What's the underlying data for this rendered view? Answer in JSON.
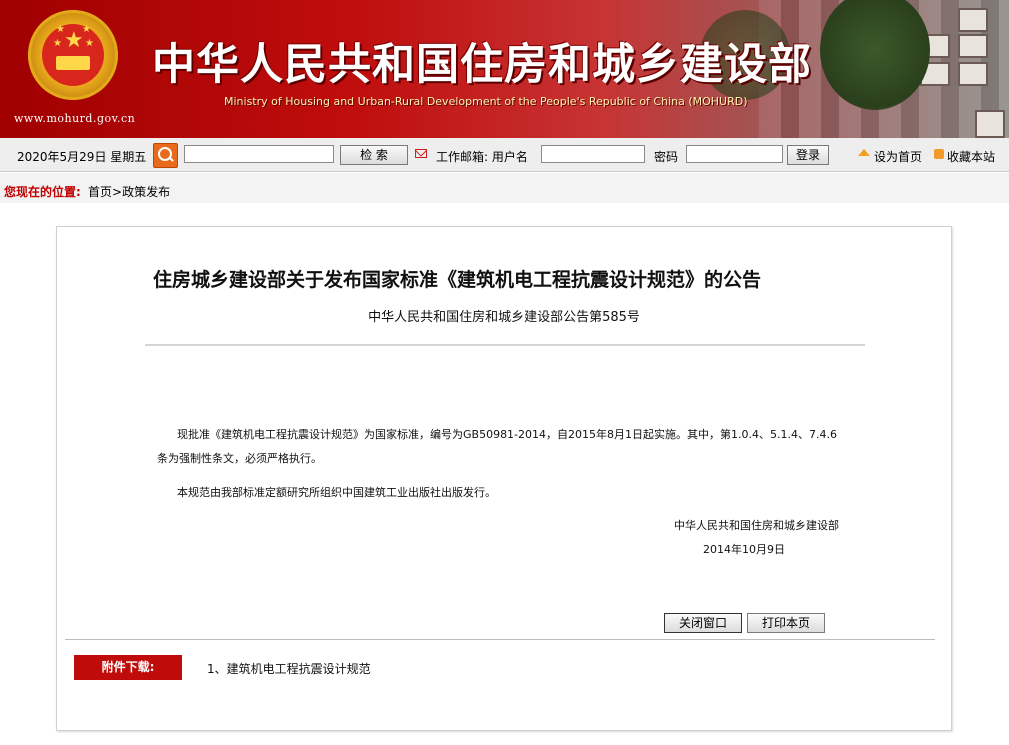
{
  "header": {
    "site_url": "www.mohurd.gov.cn",
    "title": "中华人民共和国住房和城乡建设部",
    "subtitle": "Ministry of Housing and Urban-Rural Development of the People's Republic of China (MOHURD)"
  },
  "toolbar": {
    "date": "2020年5月29日  星期五",
    "search_value": "",
    "search_button": "检    索",
    "mail_label": "工作邮箱: 用户名",
    "username_value": "",
    "password_label": "密码",
    "password_value": "",
    "login_button": "登录",
    "set_home": "设为首页",
    "bookmark": "收藏本站"
  },
  "breadcrumb": {
    "label": "您现在的位置:",
    "home": "首页",
    "separator": ">",
    "current": "政策发布"
  },
  "article": {
    "title": "住房城乡建设部关于发布国家标准《建筑机电工程抗震设计规范》的公告",
    "doc_number": "中华人民共和国住房和城乡建设部公告第585号",
    "paragraph1": "现批准《建筑机电工程抗震设计规范》为国家标准，编号为GB50981-2014，自2015年8月1日起实施。其中，第1.0.4、5.1.4、7.4.6条为强制性条文，必须严格执行。",
    "paragraph2": "本规范由我部标准定额研究所组织中国建筑工业出版社出版发行。",
    "signer": "中华人民共和国住房和城乡建设部",
    "date": "2014年10月9日",
    "close_button": "关闭窗口",
    "print_button": "打印本页",
    "attachment_label": "附件下载:",
    "attachment_link": "1、建筑机电工程抗震设计规范"
  },
  "icons": {
    "search": "search-icon",
    "mail": "mail-icon",
    "home": "home-icon",
    "bookmark": "rss-icon"
  },
  "colors": {
    "banner_red": "#c00d0d",
    "accent_red": "#c00b0b",
    "toolbar_bg": "#eeeeee"
  }
}
